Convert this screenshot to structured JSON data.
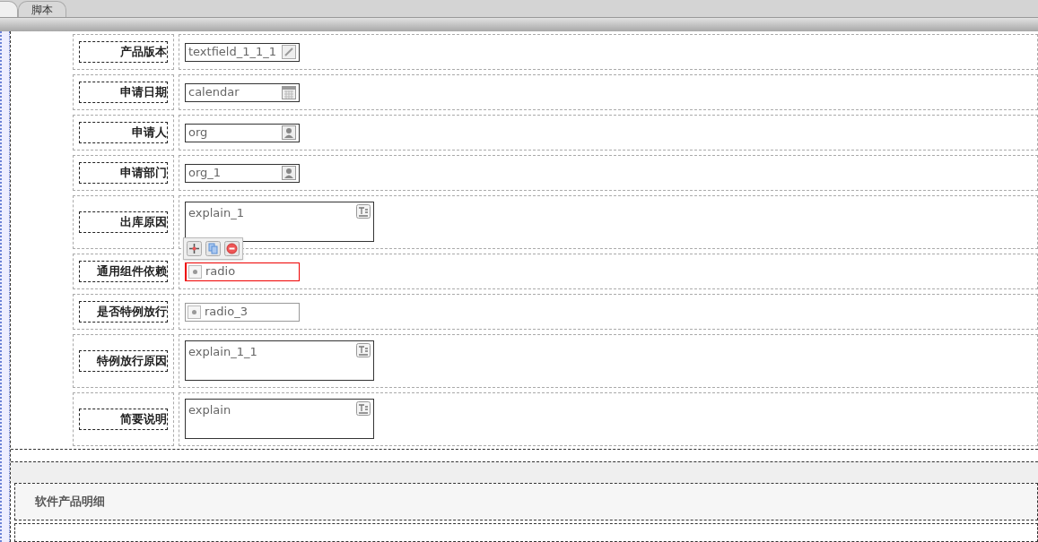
{
  "tabs": [
    {
      "label": "脚本",
      "selected": false
    }
  ],
  "form_rows": [
    {
      "label": "产品版本",
      "kind": "text",
      "value": "textfield_1_1_1"
    },
    {
      "label": "申请日期",
      "kind": "calendar",
      "value": "calendar"
    },
    {
      "label": "申请人",
      "kind": "person",
      "value": "org"
    },
    {
      "label": "申请部门",
      "kind": "person",
      "value": "org_1"
    },
    {
      "label": "出库原因",
      "kind": "textarea",
      "value": "explain_1",
      "toolbar": true
    },
    {
      "label": "通用组件依赖",
      "kind": "radio",
      "value": "radio",
      "selected": true
    },
    {
      "label": "是否特例放行",
      "kind": "radio",
      "value": "radio_3",
      "selected": false
    },
    {
      "label": "特例放行原因",
      "kind": "textarea",
      "value": "explain_1_1"
    },
    {
      "label": "简要说明",
      "kind": "textarea",
      "value": "explain"
    }
  ],
  "section": {
    "title": "软件产品明细"
  }
}
